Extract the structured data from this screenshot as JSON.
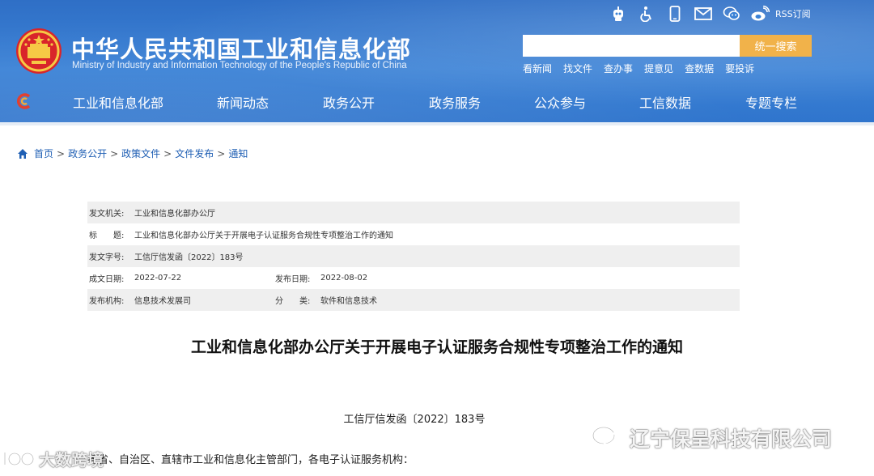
{
  "header": {
    "title": "中华人民共和国工业和信息化部",
    "subtitle": "Ministry of Industry and Information Technology of the People's Republic of China",
    "top_icons": [
      "robot-icon",
      "accessibility-icon",
      "mobile-icon",
      "mail-icon",
      "wechat-icon",
      "weibo-icon"
    ],
    "rss_label": "RSS订阅",
    "search": {
      "placeholder": "",
      "value": "",
      "button_label": "统一搜索"
    },
    "quick_links": [
      "看新闻",
      "找文件",
      "查办事",
      "提意见",
      "查数据",
      "要投诉"
    ],
    "accent_color": "#f1b24a",
    "header_color": "#3b82d6"
  },
  "nav": {
    "items": [
      "工业和信息化部",
      "新闻动态",
      "政务公开",
      "政务服务",
      "公众参与",
      "工信数据",
      "专题专栏"
    ]
  },
  "breadcrumb": [
    "首页",
    "政务公开",
    "政策文件",
    "文件发布",
    "通知"
  ],
  "meta": {
    "issuer_label": "发文机关:",
    "issuer": "工业和信息化部办公厅",
    "title_label": "标　　题:",
    "title": "工业和信息化部办公厅关于开展电子认证服务合规性专项整治工作的通知",
    "doc_no_label": "发文字号:",
    "doc_no": "工信厅信发函〔2022〕183号",
    "created_label": "成文日期:",
    "created": "2022-07-22",
    "published_label": "发布日期:",
    "published": "2022-08-02",
    "org_label": "发布机构:",
    "org": "信息技术发展司",
    "category_label": "分　　类:",
    "category": "软件和信息技术"
  },
  "article": {
    "title": "工业和信息化部办公厅关于开展电子认证服务合规性专项整治工作的通知",
    "doc_number": "工信厅信发函〔2022〕183号",
    "salutation": "各省、自治区、直辖市工业和信息化主管部门，各电子认证服务机构："
  },
  "watermarks": {
    "left": "大数跨境",
    "right": "辽宁保呈科技有限公司"
  }
}
